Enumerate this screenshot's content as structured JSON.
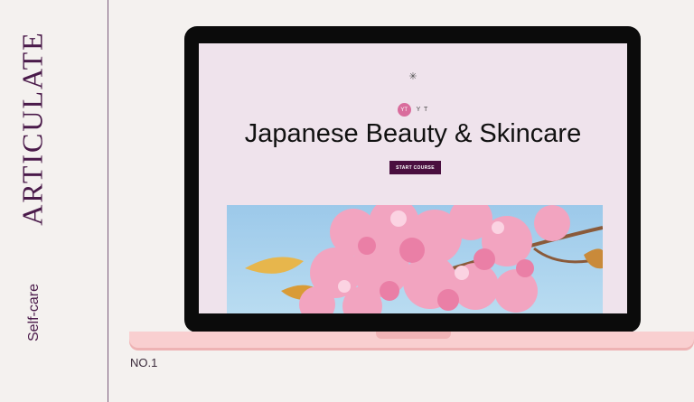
{
  "brand": {
    "name": "ARTICULATE"
  },
  "category": "Self-care",
  "edition": "NO.1",
  "screen": {
    "sparkle_icon": "✳",
    "author": {
      "avatar_initials": "YT",
      "name": "Y T"
    },
    "title": "Japanese Beauty & Skincare",
    "start_button_label": "START COURSE",
    "hero_image_icon": "cherry-blossom-image"
  },
  "colors": {
    "background": "#f4f1ef",
    "brand_text": "#4a1a4a",
    "screen_background": "#efe3ec",
    "button": "#4a0f3f",
    "avatar": "#d96c9c",
    "laptop_base": "#f9cfd0"
  }
}
